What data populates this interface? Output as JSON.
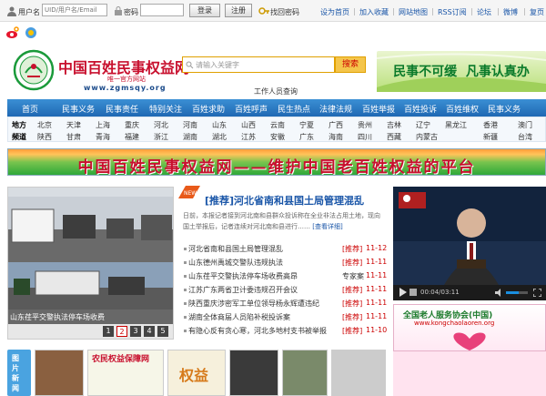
{
  "topbar": {
    "username_label": "用户名",
    "username_placeholder": "UID/用户名/Email",
    "password_label": "密码",
    "login_button": "登录",
    "register_button": "注册",
    "forgot_password": "找回密码",
    "links": [
      "设为首页",
      "加入收藏",
      "网站地图",
      "RSS订阅",
      "论坛",
      "微博",
      "复页"
    ]
  },
  "header": {
    "logo_title": "中国百姓民事权益网",
    "logo_subtitle": "唯一官方网站",
    "logo_url": "www.zgmsqy.org",
    "search_placeholder": "请输入关键字",
    "search_button": "搜索",
    "report_link": "工作人员查询",
    "slogan": "民事不可缓  凡事认真办"
  },
  "nav": {
    "items": [
      "首页",
      "民事义务",
      "民事责任",
      "特别关注",
      "百姓求助",
      "百姓呼声",
      "民生热点",
      "法律法规",
      "百姓举报",
      "百姓投诉",
      "百姓维权",
      "民事义务",
      "民事法规"
    ]
  },
  "regions": {
    "row1_label": "地方",
    "row1": [
      "北京",
      "天津",
      "上海",
      "重庆",
      "河北",
      "河南",
      "山东",
      "山西",
      "云南",
      "宁夏",
      "广西",
      "贵州",
      "吉林",
      "辽宁",
      "黑龙江",
      "香港",
      "澳门"
    ],
    "row2_label": "频道",
    "row2": [
      "陕西",
      "甘肃",
      "青海",
      "福建",
      "浙江",
      "湖南",
      "湖北",
      "江苏",
      "安徽",
      "广东",
      "海南",
      "四川",
      "西藏",
      "内蒙古",
      "新疆",
      "台湾"
    ]
  },
  "banner": {
    "text": "中国百姓民事权益网——维护中国老百姓权益的平台"
  },
  "slideshow": {
    "caption": "山东荏平交警执法停车场收费",
    "pages": [
      "1",
      "2",
      "3",
      "4",
      "5"
    ],
    "active_page": 2
  },
  "news": {
    "headline": "[推荐]河北省南和县国土局管理混乱",
    "summary": "日前，本报记者接到河北南和县群众投诉称在全业非法占用土地，现向国土举报后，记者连续对河北南和县进行……",
    "more_link": "[查看详细]",
    "items": [
      {
        "title": "河北省南和县国土局管理混乱",
        "tag": "[推荐]",
        "date": "11-12"
      },
      {
        "title": "山东德州禹城交警队违规执法",
        "tag": "[推荐]",
        "date": "11-11"
      },
      {
        "title": "山东荏平交警执法停车场收费高昂",
        "tag": "专家案",
        "date": "11-11"
      },
      {
        "title": "江苏广东两省卫计委违规召开会议",
        "tag": "[推荐]",
        "date": "11-11"
      },
      {
        "title": "陕西重庆涉密军工单位领导杨永辉遭违纪",
        "tag": "[推荐]",
        "date": "11-11"
      },
      {
        "title": "湖南全体商届人员陷补税投诉案",
        "tag": "[推荐]",
        "date": "11-11"
      },
      {
        "title": "有隐心反有贪心寒，河北多地村支书被举报",
        "tag": "[推荐]",
        "date": "11-10"
      }
    ]
  },
  "video": {
    "time": "00:04/03:11"
  },
  "ad": {
    "title": "全国老人服务协会(中国)",
    "url": "www.kongchaolaoren.org"
  },
  "bottom": {
    "left_badge": "图片新闻",
    "middle_label": "农民权益保障网",
    "right_text": "权益"
  }
}
